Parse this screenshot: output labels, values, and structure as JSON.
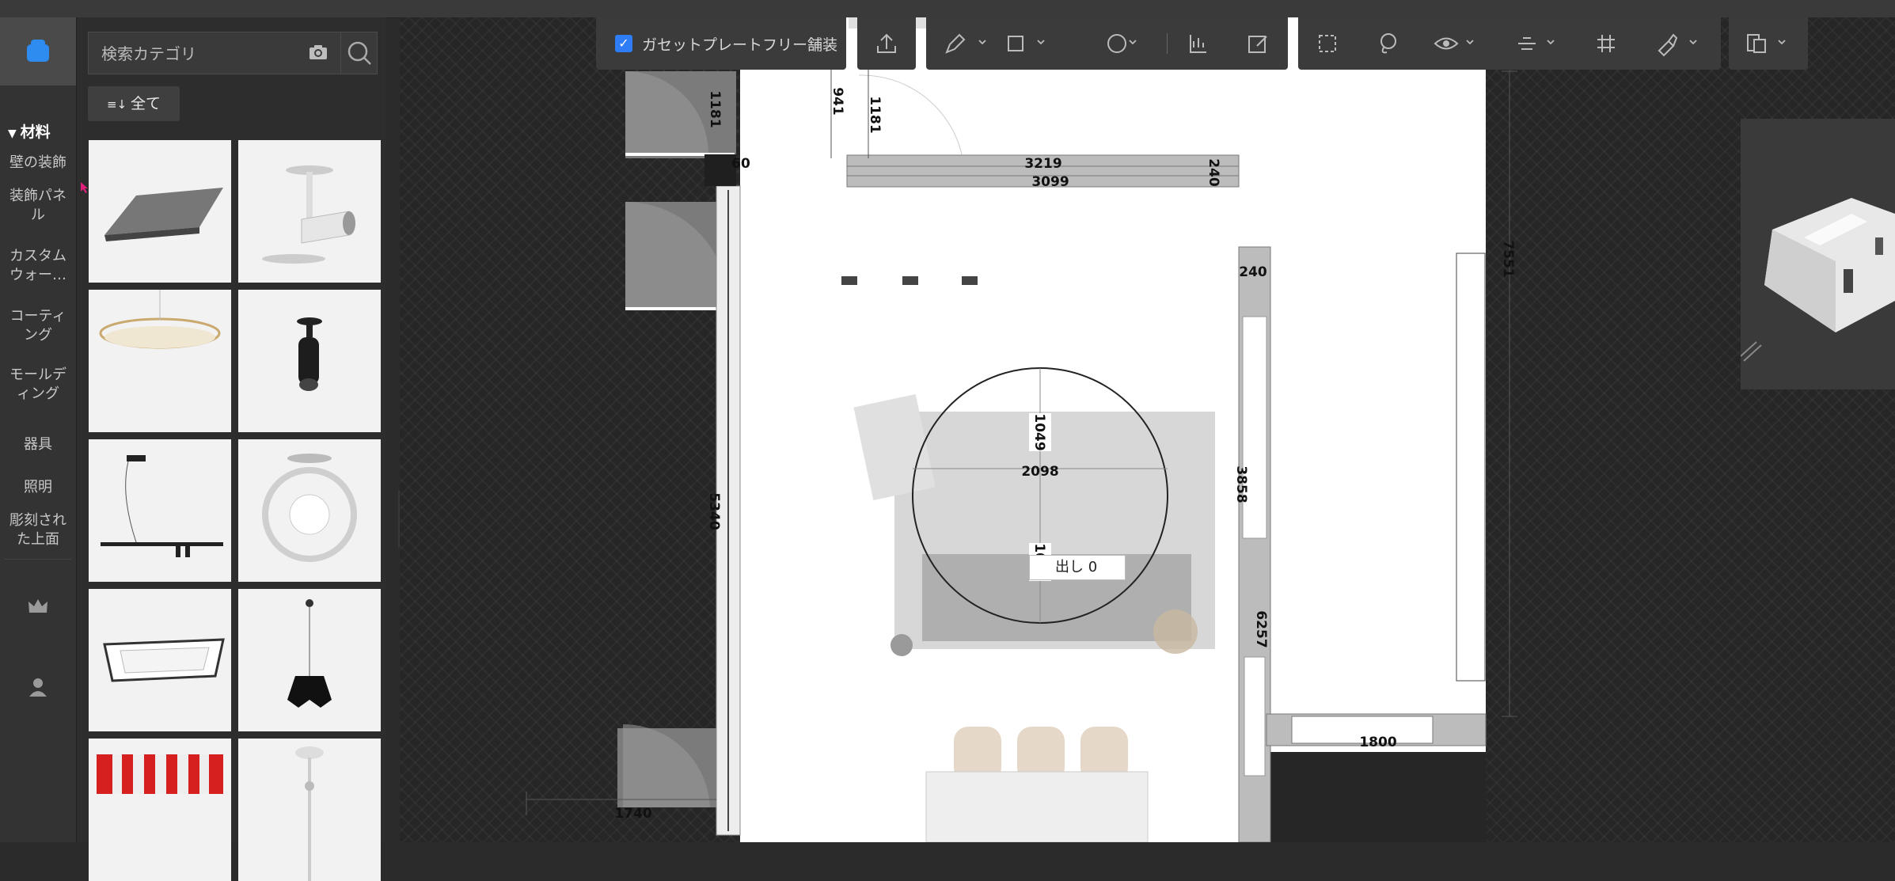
{
  "sidebar": {
    "section_title": "材料",
    "items": [
      {
        "label": "壁の装飾"
      },
      {
        "label": "装飾パネル"
      },
      {
        "label": "カスタムウォー…"
      },
      {
        "label": "コーティング"
      },
      {
        "label": "モールディング"
      },
      {
        "label": "器具"
      },
      {
        "label": "照明"
      },
      {
        "label": "彫刻された上面"
      }
    ]
  },
  "panel": {
    "search_placeholder": "検索カテゴリ",
    "all_button": "全て",
    "thumbnails": [
      {
        "name": "linear-led-panel"
      },
      {
        "name": "track-spotlight"
      },
      {
        "name": "crystal-oval-chandelier"
      },
      {
        "name": "black-pendant-spot"
      },
      {
        "name": "linear-track-system"
      },
      {
        "name": "ring-globe-lamp"
      },
      {
        "name": "square-ceiling-light"
      },
      {
        "name": "black-geometric-pendant"
      },
      {
        "name": "red-white-rolls"
      },
      {
        "name": "floor-lamp"
      }
    ]
  },
  "toolbar": {
    "checkbox_label": "ガセットプレートフリー舗装",
    "checkbox_checked": true
  },
  "floorplan": {
    "dimensions": [
      "1181",
      "941",
      "1181",
      "60",
      "3219",
      "3099",
      "240",
      "240",
      "7551",
      "1049",
      "2098",
      "1049",
      "3858",
      "6257",
      "5340",
      "1800",
      "1740"
    ],
    "tooltip_text": "出し 0"
  },
  "colors": {
    "accent": "#2e7cf6",
    "logo": "#2e8cf0",
    "background": "#2b2b2b"
  }
}
